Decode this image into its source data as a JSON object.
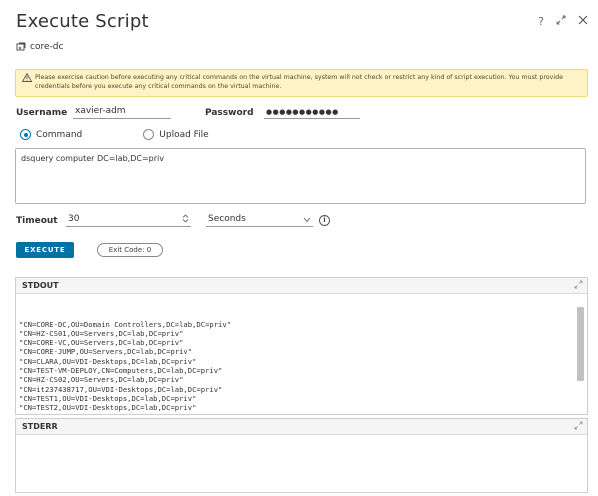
{
  "dialog": {
    "title": "Execute Script",
    "help_label": "?",
    "vm_name": "core-dc"
  },
  "warning": {
    "text": "Please exercise caution before executing any critical commands on the virtual machine, system will not check or restrict any kind of script execution. You must provide credentials before you execute any critical commands on the virtual machine."
  },
  "credentials": {
    "username_label": "Username",
    "username_value": "xavier-adm",
    "password_label": "Password",
    "password_value": "●●●●●●●●●●●"
  },
  "mode": {
    "command_label": "Command",
    "upload_label": "Upload File",
    "selected": "Command"
  },
  "script": {
    "value": "dsquery computer DC=lab,DC=priv"
  },
  "timeout": {
    "label": "Timeout",
    "value": "30",
    "unit": "Seconds"
  },
  "actions": {
    "execute_label": "EXECUTE",
    "exit_code_label": "Exit Code: 0"
  },
  "stdout": {
    "title": "STDOUT",
    "lines": [
      "\"CN=CORE-DC,OU=Domain Controllers,DC=lab,DC=priv\"",
      "\"CN=HZ-CS01,OU=Servers,DC=lab,DC=priv\"",
      "\"CN=CORE-VC,OU=Servers,DC=lab,DC=priv\"",
      "\"CN=CORE-JUMP,OU=Servers,DC=lab,DC=priv\"",
      "\"CN=CLARA,OU=VDI-Desktops,DC=lab,DC=priv\"",
      "\"CN=TEST-VM-DEPLOY,CN=Computers,DC=lab,DC=priv\"",
      "\"CN=HZ-CS02,OU=Servers,DC=lab,DC=priv\"",
      "\"CN=it237438717,OU=VDI-Desktops,DC=lab,DC=priv\"",
      "\"CN=TEST1,OU=VDI-Desktops,DC=lab,DC=priv\"",
      "\"CN=TEST2,OU=VDI-Desktops,DC=lab,DC=priv\""
    ]
  },
  "stderr": {
    "title": "STDERR"
  },
  "colors": {
    "primary": "#0072a3",
    "warning_bg": "#fdf3c4",
    "warning_border": "#f1d97a"
  }
}
